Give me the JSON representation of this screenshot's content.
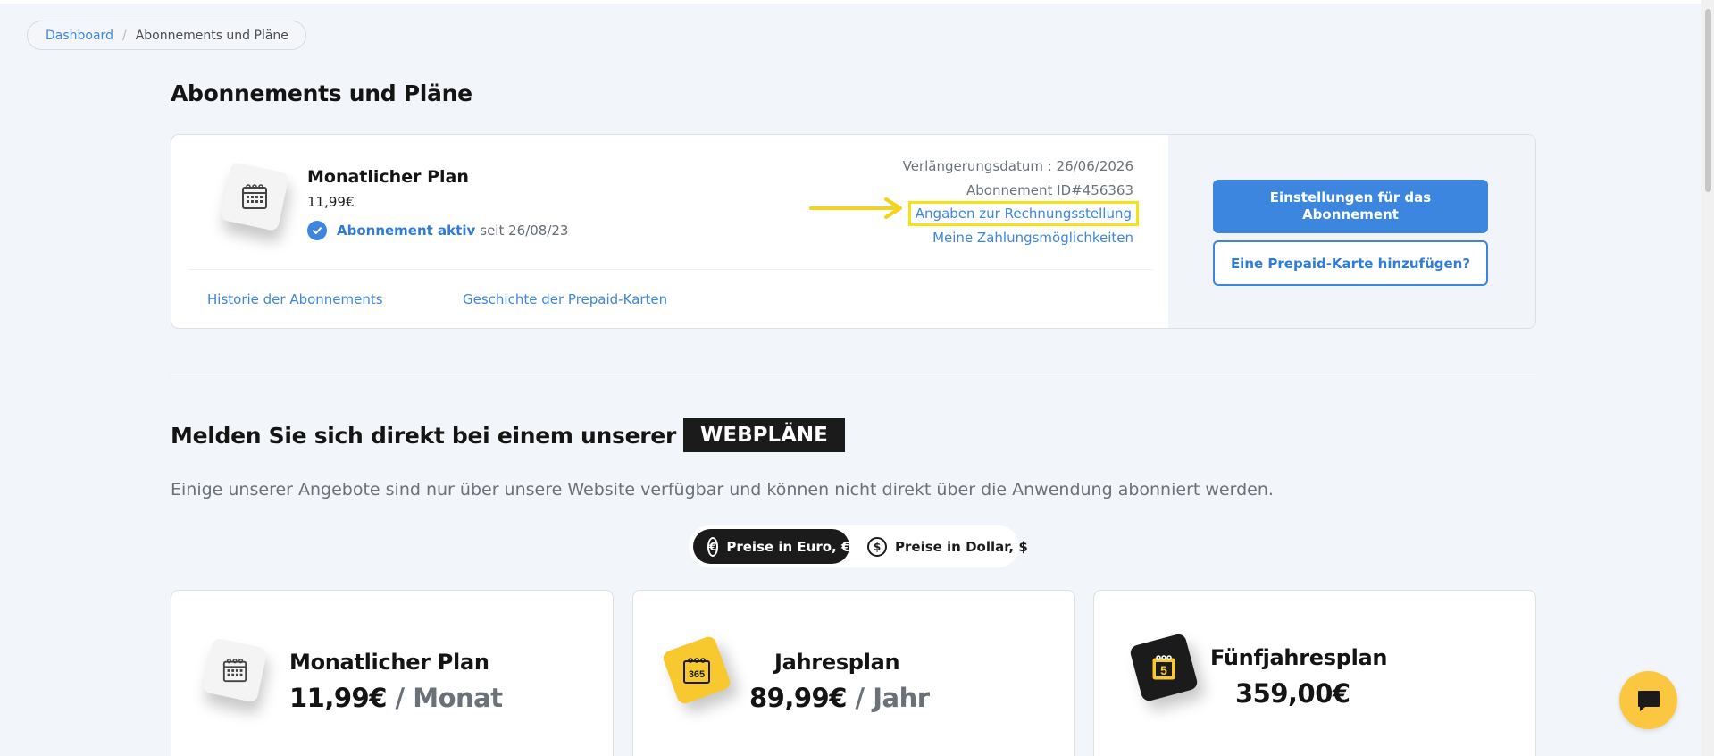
{
  "breadcrumb": {
    "home": "Dashboard",
    "separator": "/",
    "current": "Abonnements und Pläne"
  },
  "page": {
    "title": "Abonnements und Pläne"
  },
  "subscription": {
    "icon": "calendar-icon",
    "plan_name": "Monatlicher Plan",
    "price": "11,99€",
    "status_label": "Abonnement aktiv",
    "status_since": "seit 26/08/23",
    "renewal": "Verlängerungsdatum : 26/06/2026",
    "subscription_id": "Abonnement ID#456363",
    "billing_link": "Angaben zur Rechnungsstellung",
    "payment_link": "Meine Zahlungsmöglichkeiten",
    "history_link": "Historie der Abonnements",
    "prepaid_history_link": "Geschichte der Prepaid-Karten",
    "settings_button": "Einstellungen für das Abonnement",
    "prepaid_button": "Eine Prepaid-Karte hinzufügen?"
  },
  "web_plans": {
    "heading": "Melden Sie sich direkt bei einem unserer",
    "tag": "WEBPLÄNE",
    "subtitle": "Einige unserer Angebote sind nur über unsere Website verfügbar und können nicht direkt über die Anwendung abonniert werden.",
    "currency_toggle": {
      "euro_label": "Preise in Euro, €",
      "euro_symbol": "€",
      "dollar_label": "Preise in Dollar, $",
      "dollar_symbol": "$",
      "selected": "euro"
    },
    "plans": [
      {
        "title": "Monatlicher Plan",
        "price": "11,99€",
        "period": "/ Monat",
        "icon": "calendar-icon"
      },
      {
        "title": "Jahresplan",
        "price": "89,99€",
        "period": "/ Jahr",
        "icon": "calendar-365-icon",
        "icon_text": "365"
      },
      {
        "title": "Fünfjahresplan",
        "price": "359,00€",
        "period": "",
        "icon": "calendar-5-icon",
        "icon_text": "5"
      }
    ]
  },
  "colors": {
    "accent": "#3d86e0",
    "highlight": "#f5e317",
    "dark": "#1b1b1b",
    "chat": "#fbc640"
  }
}
